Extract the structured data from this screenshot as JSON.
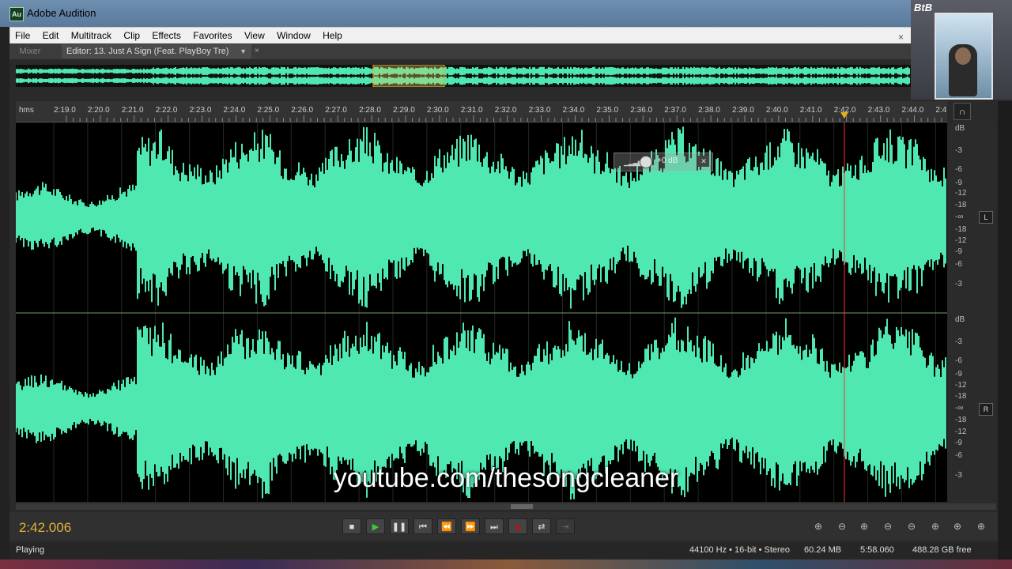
{
  "window": {
    "title": "Adobe Audition",
    "app_icon": "Au"
  },
  "menu": [
    "File",
    "Edit",
    "Multitrack",
    "Clip",
    "Effects",
    "Favorites",
    "View",
    "Window",
    "Help"
  ],
  "menu_close": "×",
  "tabs": {
    "mixer": "Mixer",
    "editor": "Editor: 13. Just A Sign (Feat. PlayBoy Tre)",
    "dropdown": "▼",
    "close": "×"
  },
  "ruler": {
    "unit": "hms",
    "ticks": [
      "2:19.0",
      "2:20.0",
      "2:21.0",
      "2:22.0",
      "2:23.0",
      "2:24.0",
      "2:25.0",
      "2:26.0",
      "2:27.0",
      "2:28.0",
      "2:29.0",
      "2:30.0",
      "2:31.0",
      "2:32.0",
      "2:33.0",
      "2:34.0",
      "2:35.0",
      "2:36.0",
      "2:37.0",
      "2:38.0",
      "2:39.0",
      "2:40.0",
      "2:41.0",
      "2:42.0",
      "2:43.0",
      "2:44.0",
      "2:4"
    ],
    "playhead_label": "2:42.0"
  },
  "db_scale": {
    "top": [
      "dB",
      "-3",
      "-6",
      "-9",
      "-12",
      "-18",
      "-∞",
      "-18",
      "-12",
      "-9",
      "-6",
      "-3"
    ],
    "bottom": [
      "dB",
      "-3",
      "-6",
      "-9",
      "-12",
      "-18",
      "-∞",
      "-18",
      "-12",
      "-9",
      "-6",
      "-3"
    ],
    "left_channel": "L",
    "right_channel": "R"
  },
  "hud": {
    "value": "+0 dB"
  },
  "watermark": "youtube.com/thesongcleaner",
  "transport": {
    "timecode": "2:42.006"
  },
  "status": {
    "state": "Playing",
    "format": "44100 Hz • 16-bit • Stereo",
    "size": "60.24 MB",
    "duration": "5:58.060",
    "free": "488.28 GB free"
  },
  "webcam": {
    "logo": "BtB"
  },
  "colors": {
    "waveform": "#4ee8b0",
    "timecode": "#e3b33a",
    "playhead": "#ff3030",
    "record": "#c01010"
  }
}
